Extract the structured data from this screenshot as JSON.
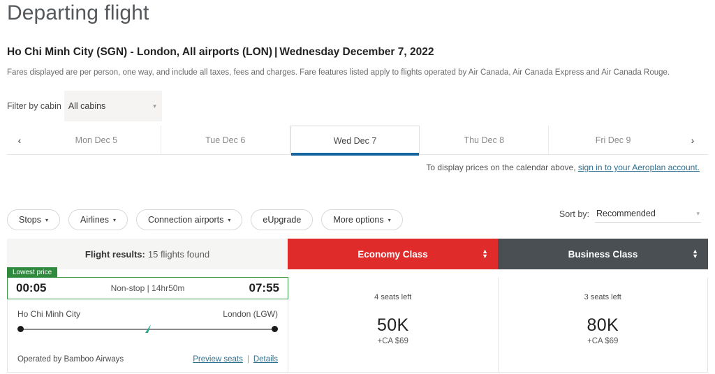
{
  "header": {
    "title": "Departing flight",
    "route_origin": "Ho Chi Minh City (SGN) - London, All airports (LON)",
    "route_separator": "|",
    "route_date": "Wednesday December 7, 2022",
    "fares_note": "Fares displayed are per person, one way, and include all taxes, fees and charges. Fare features listed apply to flights operated by Air Canada, Air Canada Express and Air Canada Rouge."
  },
  "cabin_filter": {
    "label": "Filter by cabin",
    "selected": "All cabins",
    "caret": "▾"
  },
  "calendar": {
    "prev_icon": "‹",
    "next_icon": "›",
    "tabs": [
      {
        "label": "Mon Dec 5",
        "active": false
      },
      {
        "label": "Tue Dec 6",
        "active": false
      },
      {
        "label": "Wed Dec 7",
        "active": true
      },
      {
        "label": "Thu Dec 8",
        "active": false
      },
      {
        "label": "Fri Dec 9",
        "active": false
      }
    ],
    "signin_prefix": "To display prices on the calendar above, ",
    "signin_link": "sign in to your Aeroplan account."
  },
  "filters": {
    "pills": [
      {
        "label": "Stops",
        "caret": true
      },
      {
        "label": "Airlines",
        "caret": true
      },
      {
        "label": "Connection airports",
        "caret": true
      },
      {
        "label": "eUpgrade",
        "caret": false
      },
      {
        "label": "More options",
        "caret": true
      }
    ],
    "caret_glyph": "▾",
    "sort_label": "Sort by:",
    "sort_value": "Recommended",
    "sort_caret": "▾"
  },
  "results": {
    "results_label": "Flight results:",
    "results_count": "15 flights found",
    "columns": [
      {
        "name": "Economy Class",
        "color": "#e02b2b"
      },
      {
        "name": "Business Class",
        "color": "#4a4f54"
      }
    ],
    "sort_up": "▲",
    "sort_down": "▼"
  },
  "flight": {
    "badge": "Lowest price",
    "depart_time": "00:05",
    "stops_duration": "Non-stop | 14hr50m",
    "arrive_time": "07:55",
    "origin_city": "Ho Chi Minh City",
    "destination_city": "London (LGW)",
    "operated_by": "Operated by Bamboo Airways",
    "preview_seats": "Preview seats",
    "link_divider": "|",
    "details": "Details",
    "fares": [
      {
        "seats_left": "4 seats left",
        "points": "50K",
        "cash": "+CA $69"
      },
      {
        "seats_left": "3 seats left",
        "points": "80K",
        "cash": "+CA $69"
      }
    ]
  }
}
